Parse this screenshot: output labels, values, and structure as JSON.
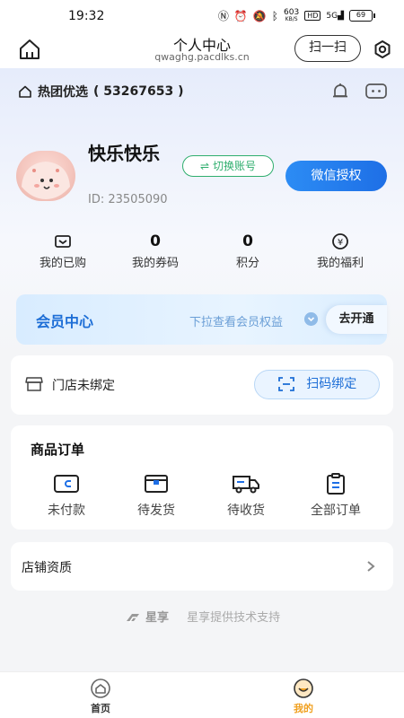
{
  "status_bar": {
    "time": "19:32",
    "network_speed": "603",
    "network_unit": "KB/S",
    "hd": "HD",
    "signal": "5G",
    "battery": "69"
  },
  "nav": {
    "title": "个人中心",
    "url": "qwaghg.pacdlks.cn",
    "scan_label": "扫一扫"
  },
  "group": {
    "label": "热团优选",
    "id_text": "( 53267653 )"
  },
  "profile": {
    "name": "快乐快乐",
    "id_text": "ID: 23505090",
    "switch_label": "切换账号",
    "switch_glyph": "⇌",
    "wechat_label": "微信授权"
  },
  "stats": [
    {
      "label": "我的已购",
      "value": "",
      "icon": "wallet-icon"
    },
    {
      "label": "我的券码",
      "value": "0"
    },
    {
      "label": "积分",
      "value": "0"
    },
    {
      "label": "我的福利",
      "value": "",
      "icon": "yen-coin-icon"
    }
  ],
  "member": {
    "title": "会员中心",
    "hint": "下拉查看会员权益",
    "button": "去开通"
  },
  "store": {
    "label": "门店未绑定",
    "bind_label": "扫码绑定"
  },
  "orders": {
    "title": "商品订单",
    "items": [
      {
        "label": "未付款",
        "icon": "wallet-card-icon"
      },
      {
        "label": "待发货",
        "icon": "box-icon"
      },
      {
        "label": "待收货",
        "icon": "truck-icon"
      },
      {
        "label": "全部订单",
        "icon": "clipboard-icon"
      }
    ]
  },
  "qualification": {
    "label": "店铺资质"
  },
  "footer": {
    "brand": "星享",
    "text": "星享提供技术支持"
  },
  "tabs": [
    {
      "label": "首页",
      "active": false
    },
    {
      "label": "我的",
      "active": true
    }
  ],
  "colors": {
    "accent_blue": "#1e6fe6",
    "switch_green": "#2fae6e",
    "active_tab": "#f0a020"
  }
}
